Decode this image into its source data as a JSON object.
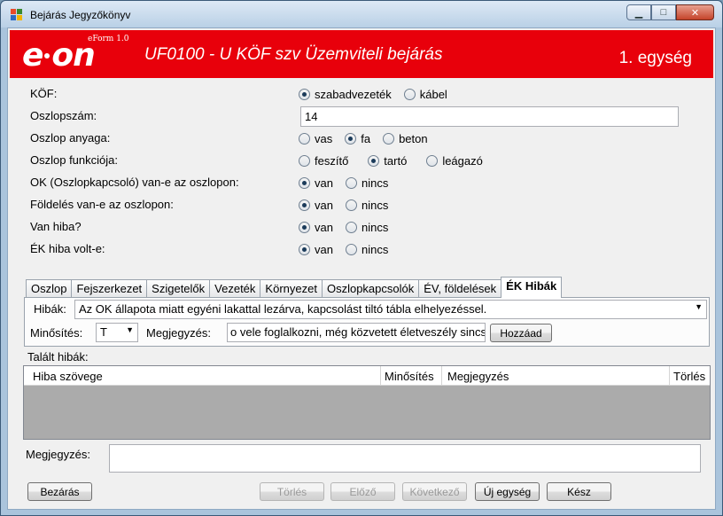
{
  "window": {
    "title": "Bejárás Jegyzőkönyv",
    "controls": {
      "minimize": "▁",
      "maximize": "□",
      "close": "✕"
    }
  },
  "banner": {
    "logo_left": "e",
    "logo_right": "on",
    "eform": "eForm 1.0",
    "title": "UF0100 - U KÖF szv Üzemviteli bejárás",
    "unit": "1. egység",
    "bg_color": "#e8000b"
  },
  "fields": {
    "kof": {
      "label": "KÖF:",
      "options": [
        {
          "label": "szabadvezeték",
          "selected": true
        },
        {
          "label": "kábel",
          "selected": false
        }
      ]
    },
    "oszlopszam": {
      "label": "Oszlopszám:",
      "value": "14"
    },
    "anyag": {
      "label": "Oszlop anyaga:",
      "options": [
        {
          "label": "vas",
          "selected": false
        },
        {
          "label": "fa",
          "selected": true
        },
        {
          "label": "beton",
          "selected": false
        }
      ]
    },
    "funkcio": {
      "label": "Oszlop funkciója:",
      "options": [
        {
          "label": "feszítő",
          "selected": false
        },
        {
          "label": "tartó",
          "selected": true
        },
        {
          "label": "leágazó",
          "selected": false
        }
      ]
    },
    "ok": {
      "label": "OK (Oszlopkapcsoló) van-e az oszlopon:",
      "options": [
        {
          "label": "van",
          "selected": true
        },
        {
          "label": "nincs",
          "selected": false
        }
      ]
    },
    "foldeles": {
      "label": "Földelés van-e az oszlopon:",
      "options": [
        {
          "label": "van",
          "selected": true
        },
        {
          "label": "nincs",
          "selected": false
        }
      ]
    },
    "hiba": {
      "label": "Van hiba?",
      "options": [
        {
          "label": "van",
          "selected": true
        },
        {
          "label": "nincs",
          "selected": false
        }
      ]
    },
    "ek_hiba": {
      "label": "ÉK hiba volt-e:",
      "options": [
        {
          "label": "van",
          "selected": true
        },
        {
          "label": "nincs",
          "selected": false
        }
      ]
    }
  },
  "tabs": [
    {
      "label": "Oszlop",
      "active": false
    },
    {
      "label": "Fejszerkezet",
      "active": false
    },
    {
      "label": "Szigetelők",
      "active": false
    },
    {
      "label": "Vezeték",
      "active": false
    },
    {
      "label": "Környezet",
      "active": false
    },
    {
      "label": "Oszlopkapcsolók",
      "active": false
    },
    {
      "label": "ÉV, földelések",
      "active": false
    },
    {
      "label": "ÉK Hibák",
      "active": true
    }
  ],
  "panel": {
    "hibak_label": "Hibák:",
    "hibak_value": "Az OK állapota miatt egyéni lakattal lezárva, kapcsolást tiltó tábla elhelyezéssel.",
    "minosites_label": "Minősítés:",
    "minosites_value": "T",
    "megjegyzes_label": "Megjegyzés:",
    "megjegyzes_value": "o vele foglalkozni, még közvetett életveszély sincs",
    "add_button": "Hozzáad"
  },
  "found": {
    "label": "Talált hibák:",
    "columns": [
      "Hiba szövege",
      "Minősítés",
      "Megjegyzés",
      "Törlés"
    ]
  },
  "note": {
    "label": "Megjegyzés:",
    "value": ""
  },
  "footer": {
    "close": "Bezárás",
    "delete": "Törlés",
    "prev": "Előző",
    "next": "Következő",
    "new_unit": "Új egység",
    "done": "Kész"
  }
}
